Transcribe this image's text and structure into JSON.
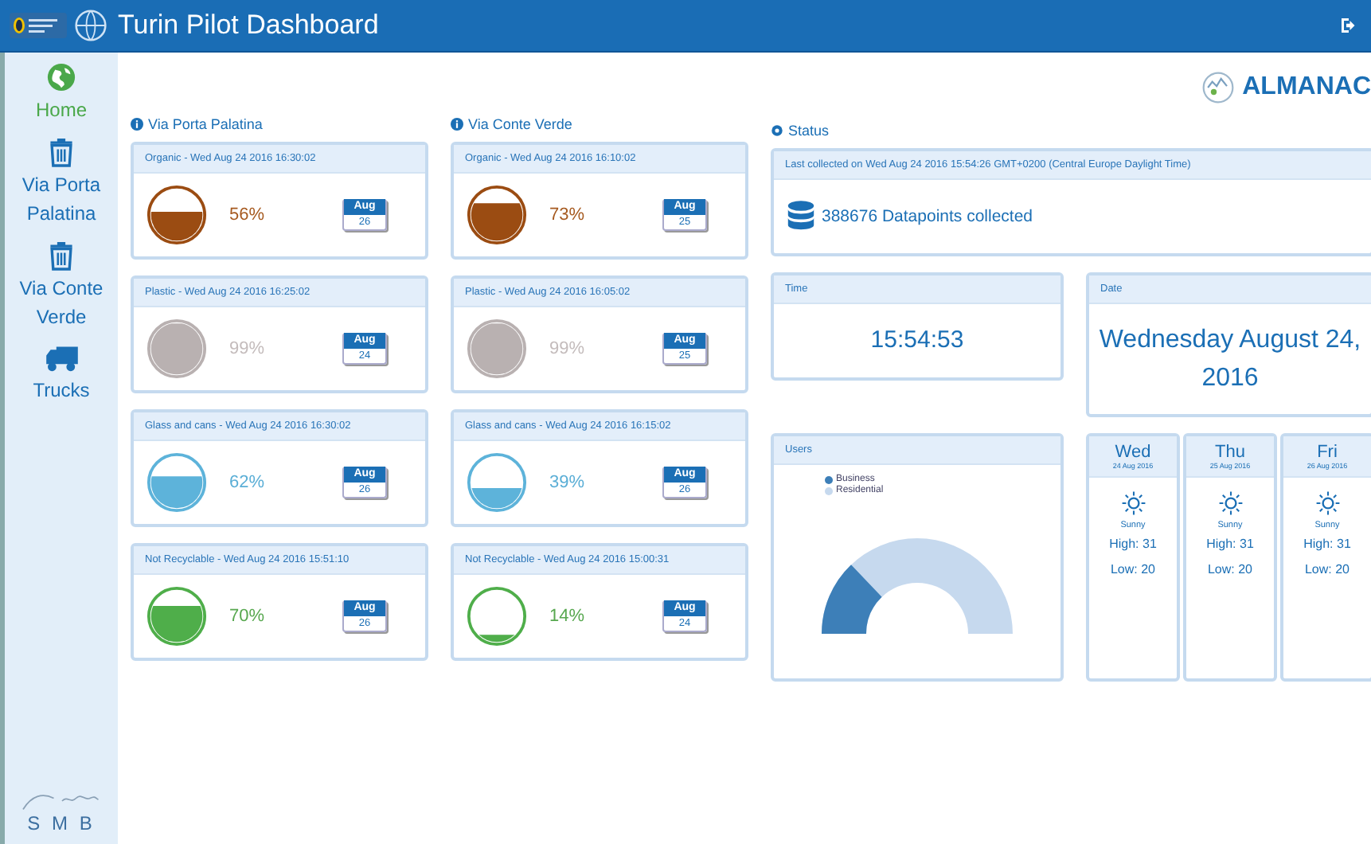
{
  "header": {
    "title": "Turin Pilot Dashboard"
  },
  "sidebar": {
    "items": [
      {
        "label": "Home",
        "kind": "home",
        "selected": true
      },
      {
        "label": "Via Porta Palatina",
        "kind": "location",
        "selected": false
      },
      {
        "label": "Via Conte Verde",
        "kind": "location",
        "selected": false
      },
      {
        "label": "Trucks",
        "kind": "fleet",
        "selected": false
      }
    ],
    "footer_logo": "S M B"
  },
  "brand": {
    "name": "ALMANAC"
  },
  "locations": [
    {
      "title": "Via Porta Palatina",
      "bins": [
        {
          "kind": "organic",
          "header": "Organic - Wed Aug 24 2016 16:30:02",
          "percent": "56%",
          "month": "Aug",
          "day": "26"
        },
        {
          "kind": "plastic",
          "header": "Plastic - Wed Aug 24 2016 16:25:02",
          "percent": "99%",
          "month": "Aug",
          "day": "24"
        },
        {
          "kind": "glass",
          "header": "Glass and cans - Wed Aug 24 2016 16:30:02",
          "percent": "62%",
          "month": "Aug",
          "day": "26"
        },
        {
          "kind": "unsorted",
          "header": "Not Recyclable - Wed Aug 24 2016 15:51:10",
          "percent": "70%",
          "month": "Aug",
          "day": "26"
        }
      ]
    },
    {
      "title": "Via Conte Verde",
      "bins": [
        {
          "kind": "organic",
          "header": "Organic - Wed Aug 24 2016 16:10:02",
          "percent": "73%",
          "month": "Aug",
          "day": "25"
        },
        {
          "kind": "plastic",
          "header": "Plastic - Wed Aug 24 2016 16:05:02",
          "percent": "99%",
          "month": "Aug",
          "day": "25"
        },
        {
          "kind": "glass",
          "header": "Glass and cans - Wed Aug 24 2016 16:15:02",
          "percent": "39%",
          "month": "Aug",
          "day": "26"
        },
        {
          "kind": "unsorted",
          "header": "Not Recyclable - Wed Aug 24 2016 15:00:31",
          "percent": "14%",
          "month": "Aug",
          "day": "24"
        }
      ]
    }
  ],
  "status": {
    "title": "Status",
    "last_collected": "Last collected on Wed Aug 24 2016 15:54:26 GMT+0200 (Central Europe Daylight Time)",
    "datapoints": "388676 Datapoints collected"
  },
  "time": {
    "title": "Time",
    "value": "15:54:53"
  },
  "date": {
    "title": "Date",
    "value": "Wednesday August 24, 2016"
  },
  "users": {
    "title": "Users",
    "legend": [
      {
        "label": "Business",
        "color": "#3d7fb8"
      },
      {
        "label": "Residential",
        "color": "#c6d9ee"
      }
    ]
  },
  "weather": [
    {
      "day": "Wed",
      "date": "24 Aug 2016",
      "condition": "Sunny",
      "high": "High: 31",
      "low": "Low: 20"
    },
    {
      "day": "Thu",
      "date": "25 Aug 2016",
      "condition": "Sunny",
      "high": "High: 31",
      "low": "Low: 20"
    },
    {
      "day": "Fri",
      "date": "26 Aug 2016",
      "condition": "Sunny",
      "high": "High: 31",
      "low": "Low: 20"
    }
  ]
}
